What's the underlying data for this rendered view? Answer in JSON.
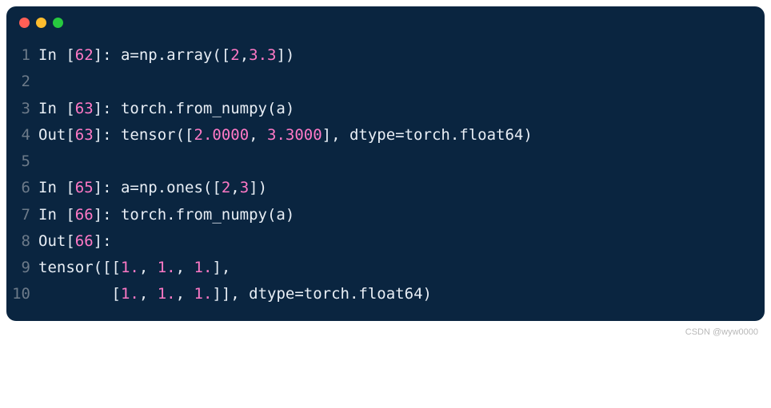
{
  "titlebar": {
    "dots": [
      "red",
      "yellow",
      "green"
    ]
  },
  "lines": [
    {
      "num": "1",
      "segments": [
        {
          "t": "In [",
          "c": "text-white"
        },
        {
          "t": "62",
          "c": "num-pink"
        },
        {
          "t": "]: a=np.array([",
          "c": "text-white"
        },
        {
          "t": "2",
          "c": "num-pink"
        },
        {
          "t": ",",
          "c": "text-white"
        },
        {
          "t": "3.3",
          "c": "num-pink"
        },
        {
          "t": "])",
          "c": "text-white"
        }
      ]
    },
    {
      "num": "2",
      "segments": []
    },
    {
      "num": "3",
      "segments": [
        {
          "t": "In [",
          "c": "text-white"
        },
        {
          "t": "63",
          "c": "num-pink"
        },
        {
          "t": "]: torch.from_numpy(a)",
          "c": "text-white"
        }
      ]
    },
    {
      "num": "4",
      "segments": [
        {
          "t": "Out[",
          "c": "text-white"
        },
        {
          "t": "63",
          "c": "num-pink"
        },
        {
          "t": "]: tensor([",
          "c": "text-white"
        },
        {
          "t": "2.0000",
          "c": "num-pink"
        },
        {
          "t": ", ",
          "c": "text-white"
        },
        {
          "t": "3.3000",
          "c": "num-pink"
        },
        {
          "t": "], dtype=torch.float64)",
          "c": "text-white"
        }
      ]
    },
    {
      "num": "5",
      "segments": []
    },
    {
      "num": "6",
      "segments": [
        {
          "t": "In [",
          "c": "text-white"
        },
        {
          "t": "65",
          "c": "num-pink"
        },
        {
          "t": "]: a=np.ones([",
          "c": "text-white"
        },
        {
          "t": "2",
          "c": "num-pink"
        },
        {
          "t": ",",
          "c": "text-white"
        },
        {
          "t": "3",
          "c": "num-pink"
        },
        {
          "t": "])",
          "c": "text-white"
        }
      ]
    },
    {
      "num": "7",
      "segments": [
        {
          "t": "In [",
          "c": "text-white"
        },
        {
          "t": "66",
          "c": "num-pink"
        },
        {
          "t": "]: torch.from_numpy(a)",
          "c": "text-white"
        }
      ]
    },
    {
      "num": "8",
      "segments": [
        {
          "t": "Out[",
          "c": "text-white"
        },
        {
          "t": "66",
          "c": "num-pink"
        },
        {
          "t": "]:",
          "c": "text-white"
        }
      ]
    },
    {
      "num": "9",
      "segments": [
        {
          "t": "tensor([[",
          "c": "text-white"
        },
        {
          "t": "1.",
          "c": "num-pink"
        },
        {
          "t": ", ",
          "c": "text-white"
        },
        {
          "t": "1.",
          "c": "num-pink"
        },
        {
          "t": ", ",
          "c": "text-white"
        },
        {
          "t": "1.",
          "c": "num-pink"
        },
        {
          "t": "],",
          "c": "text-white"
        }
      ]
    },
    {
      "num": "10",
      "segments": [
        {
          "t": "        [",
          "c": "text-white"
        },
        {
          "t": "1.",
          "c": "num-pink"
        },
        {
          "t": ", ",
          "c": "text-white"
        },
        {
          "t": "1.",
          "c": "num-pink"
        },
        {
          "t": ", ",
          "c": "text-white"
        },
        {
          "t": "1.",
          "c": "num-pink"
        },
        {
          "t": "]], dtype=torch.float64)",
          "c": "text-white"
        }
      ]
    }
  ],
  "watermark": "CSDN @wyw0000"
}
